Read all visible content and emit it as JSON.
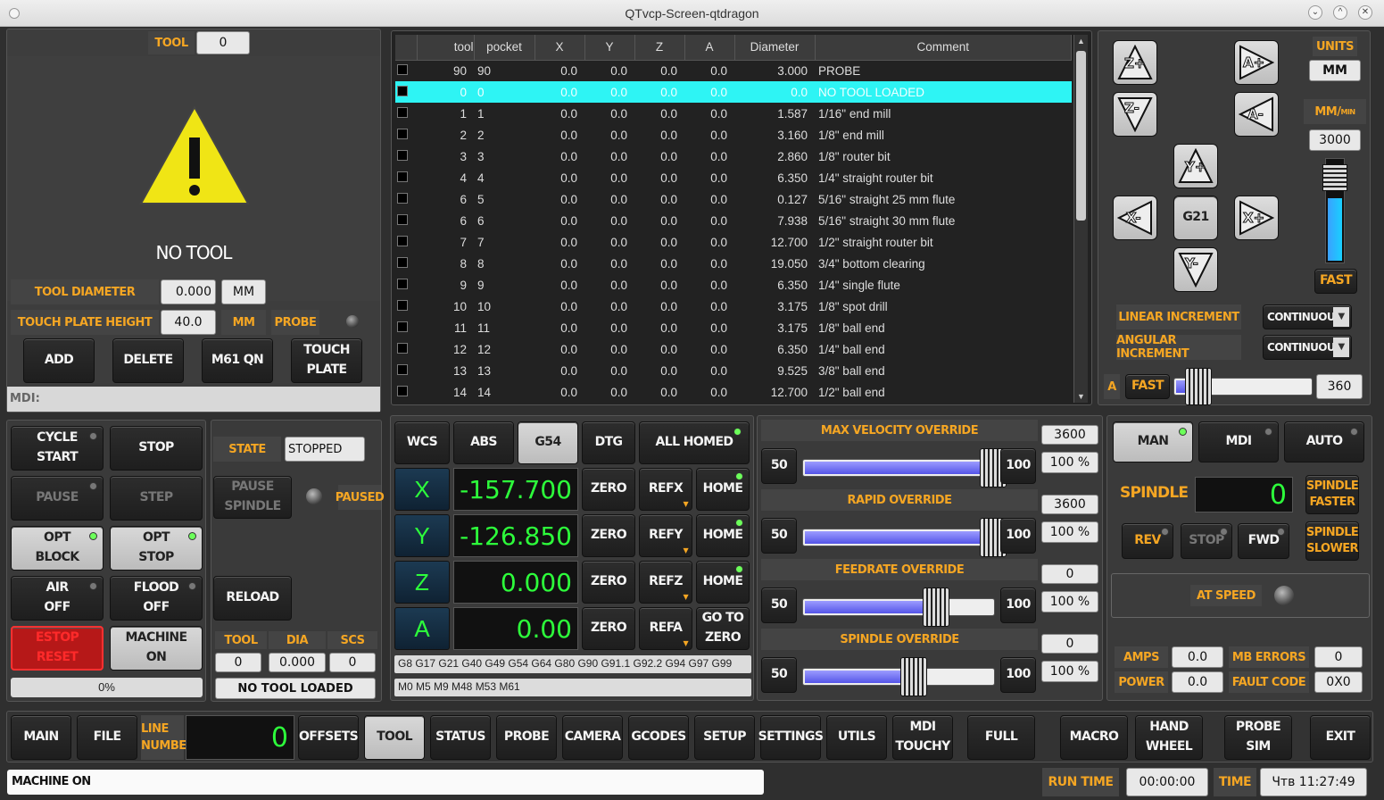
{
  "window": {
    "title": "QTvcp-Screen-qtdragon"
  },
  "tool_panel": {
    "tool_label": "TOOL",
    "tool_value": "0",
    "warning_text": "NO TOOL",
    "tool_diameter_label": "TOOL DIAMETER",
    "tool_diameter_value": "0.000",
    "tool_diameter_unit": "MM",
    "touch_plate_label": "TOUCH PLATE HEIGHT",
    "touch_plate_value": "40.0",
    "touch_plate_unit": "MM",
    "probe_label": "PROBE",
    "add": "ADD",
    "delete": "DELETE",
    "m61": "M61 QN",
    "touch_plate_1": "TOUCH",
    "touch_plate_2": "PLATE",
    "mdi": "MDI:"
  },
  "tool_table": {
    "headers": [
      "tool",
      "pocket",
      "X",
      "Y",
      "Z",
      "A",
      "Diameter",
      "Comment"
    ],
    "rows": [
      [
        "90",
        "90",
        "0.0",
        "0.0",
        "0.0",
        "0.0",
        "3.000",
        "PROBE"
      ],
      [
        "0",
        "0",
        "0.0",
        "0.0",
        "0.0",
        "0.0",
        "0.0",
        "NO TOOL LOADED"
      ],
      [
        "1",
        "1",
        "0.0",
        "0.0",
        "0.0",
        "0.0",
        "1.587",
        "1/16\" end mill"
      ],
      [
        "2",
        "2",
        "0.0",
        "0.0",
        "0.0",
        "0.0",
        "3.160",
        "1/8\" end mill"
      ],
      [
        "3",
        "3",
        "0.0",
        "0.0",
        "0.0",
        "0.0",
        "2.860",
        "1/8\" router bit"
      ],
      [
        "4",
        "4",
        "0.0",
        "0.0",
        "0.0",
        "0.0",
        "6.350",
        "1/4\" straight router bit"
      ],
      [
        "6",
        "5",
        "0.0",
        "0.0",
        "0.0",
        "0.0",
        "0.127",
        "5/16\" straight 25 mm flute"
      ],
      [
        "6",
        "6",
        "0.0",
        "0.0",
        "0.0",
        "0.0",
        "7.938",
        "5/16\" straight 30 mm flute"
      ],
      [
        "7",
        "7",
        "0.0",
        "0.0",
        "0.0",
        "0.0",
        "12.700",
        "1/2\" straight router bit"
      ],
      [
        "8",
        "8",
        "0.0",
        "0.0",
        "0.0",
        "0.0",
        "19.050",
        "3/4\" bottom clearing"
      ],
      [
        "9",
        "9",
        "0.0",
        "0.0",
        "0.0",
        "0.0",
        "6.350",
        "1/4\" single flute"
      ],
      [
        "10",
        "10",
        "0.0",
        "0.0",
        "0.0",
        "0.0",
        "3.175",
        "1/8\" spot drill"
      ],
      [
        "11",
        "11",
        "0.0",
        "0.0",
        "0.0",
        "0.0",
        "3.175",
        "1/8\" ball end"
      ],
      [
        "12",
        "12",
        "0.0",
        "0.0",
        "0.0",
        "0.0",
        "6.350",
        "1/4\" ball end"
      ],
      [
        "13",
        "13",
        "0.0",
        "0.0",
        "0.0",
        "0.0",
        "9.525",
        "3/8\" ball end"
      ],
      [
        "14",
        "14",
        "0.0",
        "0.0",
        "0.0",
        "0.0",
        "12.700",
        "1/2\" ball end"
      ]
    ]
  },
  "jog": {
    "zplus": "Z+",
    "zminus": "Z-",
    "aplus": "A+",
    "aminus": "A-",
    "yplus": "Y+",
    "yminus": "Y-",
    "xplus": "X+",
    "xminus": "X-",
    "g21": "G21",
    "units_label": "UNITS",
    "units_value": "MM",
    "rate_label": "MM/",
    "rate_sup": "MIN",
    "rate_value": "3000",
    "fast": "FAST",
    "linear_inc": "LINEAR INCREMENT",
    "angular_inc": "ANGULAR INCREMENT",
    "continuous": "CONTINUOUS",
    "a_label": "A",
    "a_fast": "FAST",
    "a_value": "360"
  },
  "control": {
    "cycle_start_1": "CYCLE",
    "cycle_start_2": "START",
    "stop": "STOP",
    "pause": "PAUSE",
    "step": "STEP",
    "opt_block_1": "OPT",
    "opt_block_2": "BLOCK",
    "opt_stop_1": "OPT",
    "opt_stop_2": "STOP",
    "air_1": "AIR",
    "air_2": "OFF",
    "flood_1": "FLOOD",
    "flood_2": "OFF",
    "estop_1": "ESTOP",
    "estop_2": "RESET",
    "machine_1": "MACHINE",
    "machine_2": "ON",
    "progress": "0%"
  },
  "state": {
    "state_label": "STATE",
    "state_value": "STOPPED",
    "pause_spindle_1": "PAUSE",
    "pause_spindle_2": "SPINDLE",
    "paused": "PAUSED",
    "reload": "RELOAD",
    "tool_h": "TOOL",
    "dia_h": "DIA",
    "scs_h": "SCS",
    "tool_v": "0",
    "dia_v": "0.000",
    "scs_v": "0",
    "loaded": "NO TOOL LOADED"
  },
  "dro": {
    "wcs": "WCS",
    "abs": "ABS",
    "g54": "G54",
    "dtg": "DTG",
    "all_homed": "ALL HOMED",
    "axes": [
      {
        "name": "X",
        "value": "-157.700",
        "ref": "REFX",
        "home": "HOME"
      },
      {
        "name": "Y",
        "value": "-126.850",
        "ref": "REFY",
        "home": "HOME"
      },
      {
        "name": "Z",
        "value": "0.000",
        "ref": "REFZ",
        "home": "HOME"
      },
      {
        "name": "A",
        "value": "0.00",
        "ref": "REFA",
        "home": "GO TO",
        "home2": "ZERO"
      }
    ],
    "zero": "ZERO",
    "gcodes": "G8 G17 G21 G40 G49 G54 G64 G80 G90 G91.1 G92.2 G94 G97 G99",
    "mcodes": "M0 M5 M9 M48 M53 M61"
  },
  "overrides": [
    {
      "title": "MAX VELOCITY OVERRIDE",
      "value": "3600",
      "pct": "100 %",
      "fill": 1.0
    },
    {
      "title": "RAPID OVERRIDE",
      "value": "3600",
      "pct": "100 %",
      "fill": 1.0
    },
    {
      "title": "FEEDRATE OVERRIDE",
      "value": "0",
      "pct": "100 %",
      "fill": 0.7
    },
    {
      "title": "SPINDLE OVERRIDE",
      "value": "0",
      "pct": "100 %",
      "fill": 0.58
    }
  ],
  "override_min": "50",
  "override_max": "100",
  "spindle": {
    "man": "MAN",
    "mdi": "MDI",
    "auto": "AUTO",
    "spindle": "SPINDLE",
    "rpm": "0",
    "faster_1": "SPINDLE",
    "faster_2": "FASTER",
    "slower_1": "SPINDLE",
    "slower_2": "SLOWER",
    "rev": "REV",
    "stop": "STOP",
    "fwd": "FWD",
    "at_speed": "AT SPEED",
    "amps": "AMPS",
    "amps_v": "0.0",
    "mb_errors": "MB ERRORS",
    "mb_v": "0",
    "power": "POWER",
    "power_v": "0.0",
    "fault": "FAULT CODE",
    "fault_v": "0X0"
  },
  "nav": {
    "main": "MAIN",
    "file": "FILE",
    "line_1": "LINE",
    "line_2": "NUMBER",
    "line_v": "0",
    "offsets": "OFFSETS",
    "tool": "TOOL",
    "status": "STATUS",
    "probe": "PROBE",
    "camera": "CAMERA",
    "gcodes": "GCODES",
    "setup": "SETUP",
    "settings": "SETTINGS",
    "utils": "UTILS",
    "mdi_1": "MDI",
    "mdi_2": "TOUCHY",
    "full": "FULL",
    "macro": "MACRO",
    "hand_1": "HAND",
    "hand_2": "WHEEL",
    "probe_sim_1": "PROBE",
    "probe_sim_2": "SIM",
    "exit": "EXIT"
  },
  "status": {
    "message": "MACHINE ON",
    "run_time_label": "RUN TIME",
    "run_time": "00:00:00",
    "time_label": "TIME",
    "time": "Чтв 11:27:49"
  },
  "colors": {
    "accent": "#f5a623",
    "dro": "#2dff3b",
    "selection": "#2ef4f4"
  }
}
